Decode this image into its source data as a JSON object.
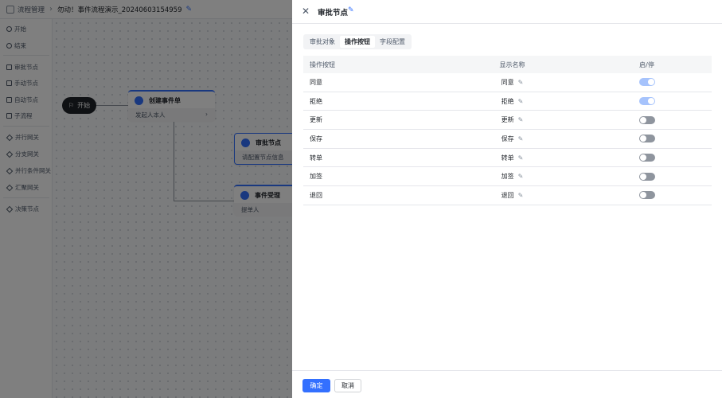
{
  "topbar": {
    "breadcrumb": "流程管理",
    "title": "勿动！事件流程演示_20240603154959"
  },
  "sidebar": {
    "items": [
      {
        "label": "开始",
        "shape": "dot"
      },
      {
        "label": "结束",
        "shape": "dot"
      },
      {
        "label": "审批节点",
        "shape": "sq"
      },
      {
        "label": "手动节点",
        "shape": "sq"
      },
      {
        "label": "自动节点",
        "shape": "sq"
      },
      {
        "label": "子流程",
        "shape": "sq"
      },
      {
        "label": "并行网关",
        "shape": "dia"
      },
      {
        "label": "分支网关",
        "shape": "dia"
      },
      {
        "label": "并行条件网关",
        "shape": "dia"
      },
      {
        "label": "汇聚网关",
        "shape": "dia"
      },
      {
        "label": "决策节点",
        "shape": "dia"
      }
    ]
  },
  "canvas": {
    "start_label": "开始",
    "nodes": [
      {
        "title": "创建事件单",
        "sub": "发起人本人"
      },
      {
        "title": "审批节点",
        "sub": "请配置节点信息"
      },
      {
        "title": "事件受理",
        "sub": "提单人"
      }
    ]
  },
  "drawer": {
    "title": "审批节点",
    "tabs": [
      {
        "label": "审批对象",
        "active": false
      },
      {
        "label": "操作按钮",
        "active": true
      },
      {
        "label": "字段配置",
        "active": false
      }
    ],
    "columns": [
      "操作按钮",
      "显示名称",
      "启/停"
    ],
    "rows": [
      {
        "button": "同意",
        "display": "同意",
        "enabled": true
      },
      {
        "button": "拒绝",
        "display": "拒绝",
        "enabled": true
      },
      {
        "button": "更新",
        "display": "更新",
        "enabled": false
      },
      {
        "button": "保存",
        "display": "保存",
        "enabled": false
      },
      {
        "button": "转单",
        "display": "转单",
        "enabled": false
      },
      {
        "button": "加签",
        "display": "加签",
        "enabled": false
      },
      {
        "button": "退回",
        "display": "退回",
        "enabled": false
      }
    ],
    "ok_label": "确定",
    "cancel_label": "取消"
  },
  "colors": {
    "primary": "#3370ff",
    "toggle_on": "#a6c3fc",
    "toggle_off": "#8f959e"
  }
}
